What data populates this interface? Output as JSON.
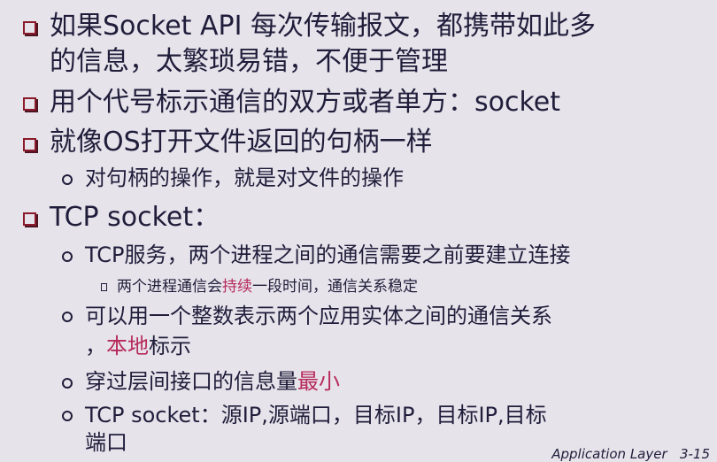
{
  "slide": {
    "b1": {
      "line1": "如果Socket API 每次传输报文，都携带如此多",
      "line2": "的信息，太繁琐易错，不便于管理"
    },
    "b2": {
      "text": "用个代号标示通信的双方或者单方：socket"
    },
    "b3": {
      "text": "就像OS打开文件返回的句柄一样"
    },
    "b3_1": {
      "text": "对句柄的操作，就是对文件的操作"
    },
    "b4": {
      "text": "TCP socket："
    },
    "b4_1": {
      "text": "TCP服务，两个进程之间的通信需要之前要建立连接"
    },
    "b4_1_1": {
      "pre": "两个进程通信会",
      "hl": "持续",
      "post": "一段时间，通信关系稳定"
    },
    "b4_2": {
      "line1": "可以用一个整数表示两个应用实体之间的通信关系",
      "line2_pre": "，",
      "line2_hl": "本地",
      "line2_post": "标示"
    },
    "b4_3": {
      "pre": "穿过层间接口的信息量",
      "hl": "最小"
    },
    "b4_4": {
      "line1": "TCP socket：源IP,源端口，目标IP，目标IP,目标",
      "line2": "端口"
    }
  },
  "footer": {
    "label": "Application Layer",
    "page": "3-15"
  },
  "colors": {
    "background": "#e7e3eb",
    "text": "#1f1d3a",
    "bullet": "#8b1a2b",
    "highlight": "#b62a5a"
  }
}
